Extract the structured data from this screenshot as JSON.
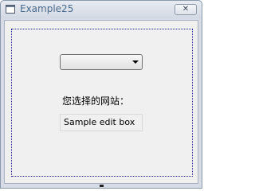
{
  "window": {
    "title": "Example25",
    "close_glyph": "✕"
  },
  "main": {
    "combo": {
      "selected": "",
      "icon": "chevron-down-icon"
    },
    "label": "您选择的网站：",
    "edit_box": {
      "value": "Sample edit box"
    }
  },
  "colors": {
    "title_text": "#4a6a8c",
    "client_bg": "#f0f0f0",
    "focus_border": "#1a1a8c"
  }
}
